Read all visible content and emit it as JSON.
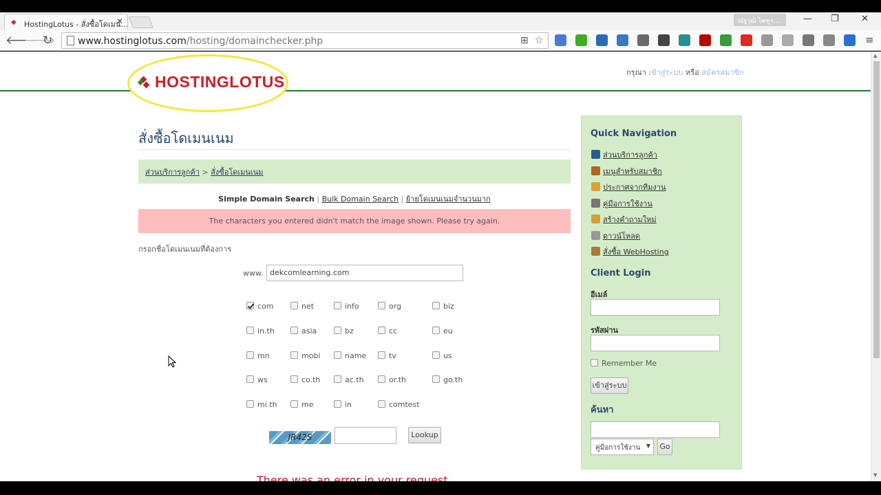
{
  "browser": {
    "tab_title": "HostingLotus - สั่งซื้อโดเมน...",
    "tab_close": "✕",
    "profile_name": "ณัฐวุฒิ ไพฑูร...",
    "window_controls": {
      "minimize": "—",
      "restore": "❐",
      "close": "✕"
    },
    "url_domain": "www.hostinglotus.com",
    "url_path": "/hosting/domainchecker.php",
    "extensions": [
      {
        "name": "translate-icon",
        "color": "#4a7bd0"
      },
      {
        "name": "plugin-green-icon",
        "color": "#3fae29"
      },
      {
        "name": "arrow-extension-icon",
        "color": "#2d6bb5"
      },
      {
        "name": "shield-extension-icon",
        "color": "#3b78c5"
      },
      {
        "name": "moon-extension-icon",
        "color": "#6b6b6b"
      },
      {
        "name": "qr-extension-icon",
        "color": "#444444"
      },
      {
        "name": "wave-extension-icon",
        "color": "#2a8f8f"
      },
      {
        "name": "pdf-extension-icon",
        "color": "#b30b00"
      },
      {
        "name": "cors-extension-icon",
        "color": "#3a9b3a"
      },
      {
        "name": "red-extension-icon",
        "color": "#d62d20"
      },
      {
        "name": "tools-extension-icon",
        "color": "#999999"
      },
      {
        "name": "angular-extension-icon",
        "color": "#aaaaaa"
      },
      {
        "name": "wordpress-extension-icon",
        "color": "#777777"
      },
      {
        "name": "download-extension-icon",
        "color": "#888888"
      },
      {
        "name": "screen-extension-icon",
        "color": "#2b6fd6"
      }
    ]
  },
  "site": {
    "logo_text": "HOSTINGLOTUS",
    "login_prompt": {
      "prefix": "กรุณา",
      "login_link": "เข้าสู่ระบบ",
      "or": "หรือ",
      "register_link": "สมัครสมาชิก"
    }
  },
  "main": {
    "page_title": "สั่งซื้อโดเมนเนม",
    "breadcrumb": {
      "home": "ส่วนบริการลูกค้า",
      "separator": ">",
      "current": "สั่งซื้อโดเมนเนม"
    },
    "modes": {
      "simple": "Simple Domain Search",
      "bulk": "Bulk Domain Search",
      "transfer": "ย้ายโดเมนเนมจำนวนมาก",
      "separator": "|"
    },
    "error_message": "The characters you entered didn't match the image shown. Please try again.",
    "enter_label": "กรอกชื่อโดเมนเนมที่ต้องการ",
    "www_label": "www.",
    "domain_value": "dekcomlearning.com",
    "tlds": [
      {
        "label": "com",
        "checked": true
      },
      {
        "label": "net",
        "checked": false
      },
      {
        "label": "info",
        "checked": false
      },
      {
        "label": "org",
        "checked": false
      },
      {
        "label": "biz",
        "checked": false
      },
      {
        "label": "in.th",
        "checked": false
      },
      {
        "label": "asia",
        "checked": false
      },
      {
        "label": "bz",
        "checked": false
      },
      {
        "label": "cc",
        "checked": false
      },
      {
        "label": "eu",
        "checked": false
      },
      {
        "label": "mn",
        "checked": false
      },
      {
        "label": "mobi",
        "checked": false
      },
      {
        "label": "name",
        "checked": false
      },
      {
        "label": "tv",
        "checked": false
      },
      {
        "label": "us",
        "checked": false
      },
      {
        "label": "ws",
        "checked": false
      },
      {
        "label": "co.th",
        "checked": false
      },
      {
        "label": "ac.th",
        "checked": false
      },
      {
        "label": "or.th",
        "checked": false
      },
      {
        "label": "go.th",
        "checked": false
      },
      {
        "label": "mi.th",
        "checked": false
      },
      {
        "label": "me",
        "checked": false
      },
      {
        "label": "in",
        "checked": false
      },
      {
        "label": "comtest",
        "checked": false
      }
    ],
    "captcha_text": "JR42S",
    "captcha_value": "",
    "lookup_label": "Lookup",
    "error_request": "There was an error in your request"
  },
  "sidebar": {
    "quick_nav_title": "Quick Navigation",
    "nav_items": [
      {
        "label": "ส่วนบริการลูกค้า",
        "icon": "globe-icon",
        "color": "#2c5c8c"
      },
      {
        "label": "เมนูสำหรับสมาชิก",
        "icon": "home-icon",
        "color": "#b5651d"
      },
      {
        "label": "ประกาศจากทีมงาน",
        "icon": "announcement-icon",
        "color": "#e0a030"
      },
      {
        "label": "คู่มือการใช้งาน",
        "icon": "magnifier-icon",
        "color": "#777777"
      },
      {
        "label": "สร้างคำถามใหม่",
        "icon": "pencil-icon",
        "color": "#d4a030"
      },
      {
        "label": "ดาวน์โหลด",
        "icon": "disc-icon",
        "color": "#999999"
      },
      {
        "label": "สั่งซื้อ WebHosting",
        "icon": "box-icon",
        "color": "#a67c3c"
      }
    ],
    "client_login_title": "Client Login",
    "email_label": "อีเมล์",
    "email_value": "",
    "password_label": "รหัสผ่าน",
    "password_value": "",
    "remember_label": "Remember Me",
    "login_button": "เข้าสู่ระบบ",
    "search_title": "ค้นหา",
    "search_value": "",
    "search_select": "คู่มือการใช้งาน",
    "go_button": "Go"
  }
}
